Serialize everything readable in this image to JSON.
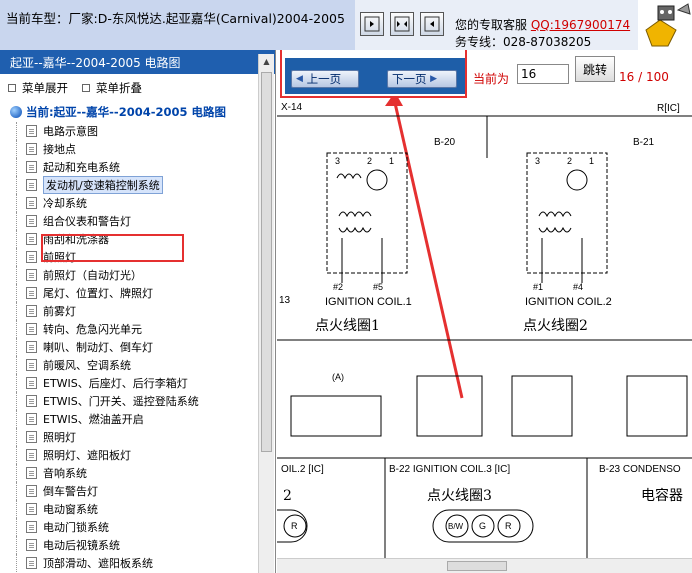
{
  "header": {
    "title": "当前车型：厂家:D-东风悦达.起亚嘉华(Carnival)2004-2005",
    "contact_label": "您的专取客服",
    "qq": "QQ:1967900174",
    "hotline": "务专线：028-87038205"
  },
  "sidebar": {
    "header": "起亚--嘉华--2004-2005 电路图",
    "expand_all": "菜单展开",
    "collapse_all": "菜单折叠",
    "root": "当前:起亚--嘉华--2004-2005 电路图",
    "items": [
      {
        "label": "电路示意图"
      },
      {
        "label": "接地点"
      },
      {
        "label": "起动和充电系统"
      },
      {
        "label": "发动机/变速箱控制系统"
      },
      {
        "label": "冷却系统"
      },
      {
        "label": "组合仪表和警告灯"
      },
      {
        "label": "雨刮和洗涤器"
      },
      {
        "label": "前照灯"
      },
      {
        "label": "前照灯（自动灯光）"
      },
      {
        "label": "尾灯、位置灯、牌照灯"
      },
      {
        "label": "前雾灯"
      },
      {
        "label": "转向、危急闪光单元"
      },
      {
        "label": "喇叭、制动灯、倒车灯"
      },
      {
        "label": "前暖风、空调系统"
      },
      {
        "label": "ETWIS、后座灯、后行李箱灯"
      },
      {
        "label": "ETWIS、门开关、遥控登陆系统"
      },
      {
        "label": "ETWIS、燃油盖开启"
      },
      {
        "label": "照明灯"
      },
      {
        "label": "照明灯、遮阳板灯"
      },
      {
        "label": "音响系统"
      },
      {
        "label": "倒车警告灯"
      },
      {
        "label": "电动窗系统"
      },
      {
        "label": "电动门锁系统"
      },
      {
        "label": "电动后视镜系统"
      },
      {
        "label": "顶部滑动、遮阳板系统"
      }
    ]
  },
  "pager": {
    "prev": "上一页",
    "next": "下一页",
    "current_label": "当前为",
    "current_value": "16",
    "jump": "跳转",
    "page_count": "16 / 100"
  },
  "diagram": {
    "x14": "X-14",
    "b20": "B-20",
    "b21": "B-21",
    "ric": "R[IC]",
    "pin3": "3",
    "pin2": "2",
    "pin1": "1",
    "pin2b": "2",
    "ign_coil1": "IGNITION COIL.1",
    "ign_coil2": "IGNITION COIL.2",
    "coil1_cn": "点火线圈1",
    "coil2_cn": "点火线圈2",
    "n13": "13",
    "a_label": "(A)",
    "pins1": "#2",
    "pins2": "#5",
    "pins3": "#1",
    "pins4": "#4",
    "coil2_ic": "OIL.2 [IC]",
    "b22": "B-22 IGNITION COIL.3 [IC]",
    "b23": "B-23 CONDENSO",
    "coil3_cn": "点火线圈3",
    "cond_cn": "电容器",
    "pin_r": "R",
    "pin_bw": "B/W",
    "pin_g": "G",
    "left_2": "2"
  }
}
